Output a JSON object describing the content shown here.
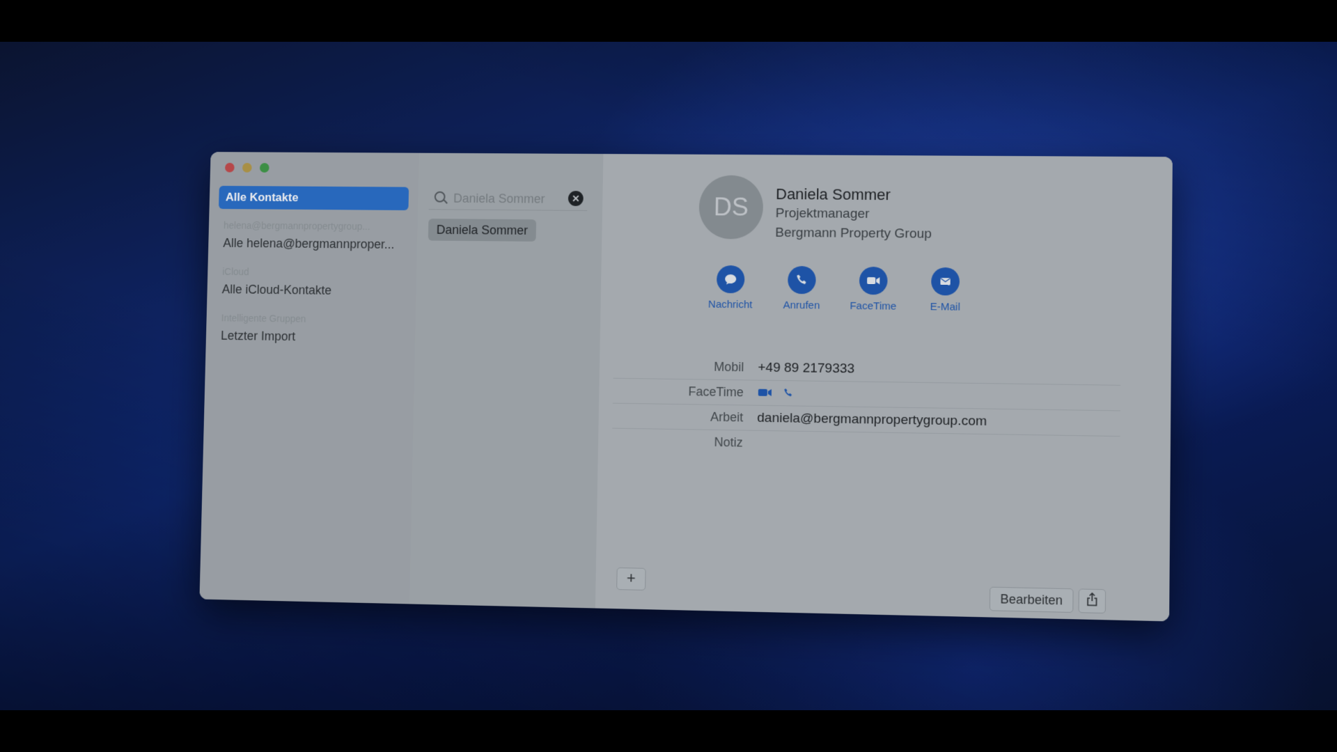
{
  "sidebar": {
    "selected": "Alle Kontakte",
    "account_header": "helena@bergmannpropertygroup...",
    "account_item": "Alle helena@bergmannproper...",
    "icloud_header": "iCloud",
    "icloud_item": "Alle iCloud-Kontakte",
    "smart_header": "Intelligente Gruppen",
    "smart_item": "Letzter Import"
  },
  "search": {
    "placeholder": "Daniela Sommer",
    "clear_glyph": "✕"
  },
  "list": {
    "result": "Daniela Sommer"
  },
  "contact": {
    "initials": "DS",
    "name": "Daniela Sommer",
    "title": "Projektmanager",
    "company": "Bergmann Property Group",
    "actions": {
      "message": "Nachricht",
      "call": "Anrufen",
      "facetime": "FaceTime",
      "email": "E-Mail"
    },
    "fields": {
      "mobile_label": "Mobil",
      "mobile_value": "+49 89 2179333",
      "facetime_label": "FaceTime",
      "work_label": "Arbeit",
      "work_value": "daniela@bergmannpropertygroup.com",
      "note_label": "Notiz"
    }
  },
  "footer": {
    "add_glyph": "+",
    "edit_label": "Bearbeiten"
  },
  "colors": {
    "accent": "#1f58b0",
    "selection": "#2a6fc8"
  }
}
